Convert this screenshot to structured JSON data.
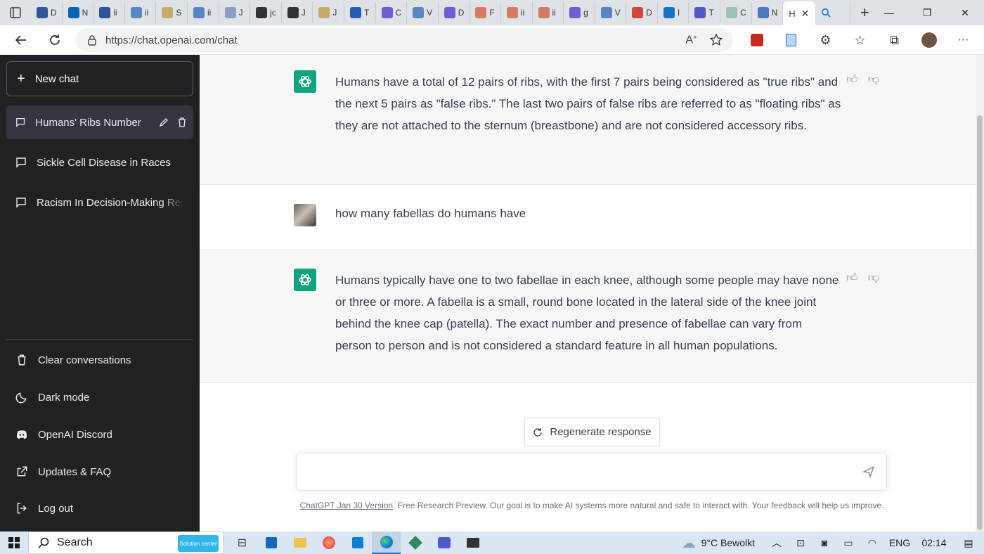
{
  "browser": {
    "url": "https://chat.openai.com/chat",
    "active_tab_letter": "H",
    "mini_tab_letters": [
      "D",
      "N",
      "ii",
      "ii",
      "S",
      "ii",
      "J",
      "jo",
      "J",
      "J",
      "T",
      "C",
      "V",
      "D",
      "F",
      "ii",
      "ii",
      "g",
      "V",
      "D",
      "I",
      "T",
      "C",
      "N"
    ],
    "tab_colors": [
      "#2b579a",
      "#0364b8",
      "#2b579a",
      "#5b86c5",
      "#c8a86b",
      "#5b86c5",
      "#8ba0c4",
      "#333333",
      "#333333",
      "#c8a86b",
      "#1f5eb8",
      "#6b5fd3",
      "#5b86c5",
      "#6b5fd3",
      "#d77a61",
      "#d77a61",
      "#d77a61",
      "#6b5fd3",
      "#5b86c5",
      "#d44638",
      "#1672c9",
      "#5059c9",
      "#9bc2b2",
      "#4a78c2"
    ]
  },
  "sidebar": {
    "new_chat_label": "New chat",
    "conversations": [
      {
        "label": "Humans' Ribs Number",
        "active": true
      },
      {
        "label": "Sickle Cell Disease in Races",
        "active": false
      },
      {
        "label": "Racism In Decision-Making Rej",
        "active": false
      }
    ],
    "bottom_items": [
      {
        "label": "Clear conversations",
        "icon": "trash-icon"
      },
      {
        "label": "Dark mode",
        "icon": "moon-icon"
      },
      {
        "label": "OpenAI Discord",
        "icon": "discord-icon"
      },
      {
        "label": "Updates & FAQ",
        "icon": "external-link-icon"
      },
      {
        "label": "Log out",
        "icon": "logout-icon"
      }
    ]
  },
  "messages": [
    {
      "role": "assistant",
      "text": "Humans have a total of 12 pairs of ribs, with the first 7 pairs being considered as \"true ribs\" and the next 5 pairs as \"false ribs.\" The last two pairs of false ribs are referred to as \"floating ribs\" as they are not attached to the sternum (breastbone) and are not considered accessory ribs."
    },
    {
      "role": "user",
      "text": "how many fabellas do humans have"
    },
    {
      "role": "assistant",
      "text": "Humans typically have one to two fabellae in each knee, although some people may have none or three or more. A fabella is a small, round bone located in the lateral side of the knee joint behind the knee cap (patella). The exact number and presence of fabellae can vary from person to person and is not considered a standard feature in all human populations."
    }
  ],
  "composer": {
    "regenerate_label": "Regenerate response",
    "input_value": "",
    "footer_link": "ChatGPT Jan 30 Version",
    "footer_text": ". Free Research Preview. Our goal is to make AI systems more natural and safe to interact with. Your feedback will help us improve."
  },
  "taskbar": {
    "search_label": "Search",
    "search_promo": "Solution center",
    "weather": "9°C  Bewolkt",
    "language": "ENG",
    "time": "02:14"
  },
  "colors": {
    "sidebar_bg": "#202123",
    "accent_green": "#10a37f",
    "assistant_bg": "#f7f7f8"
  }
}
